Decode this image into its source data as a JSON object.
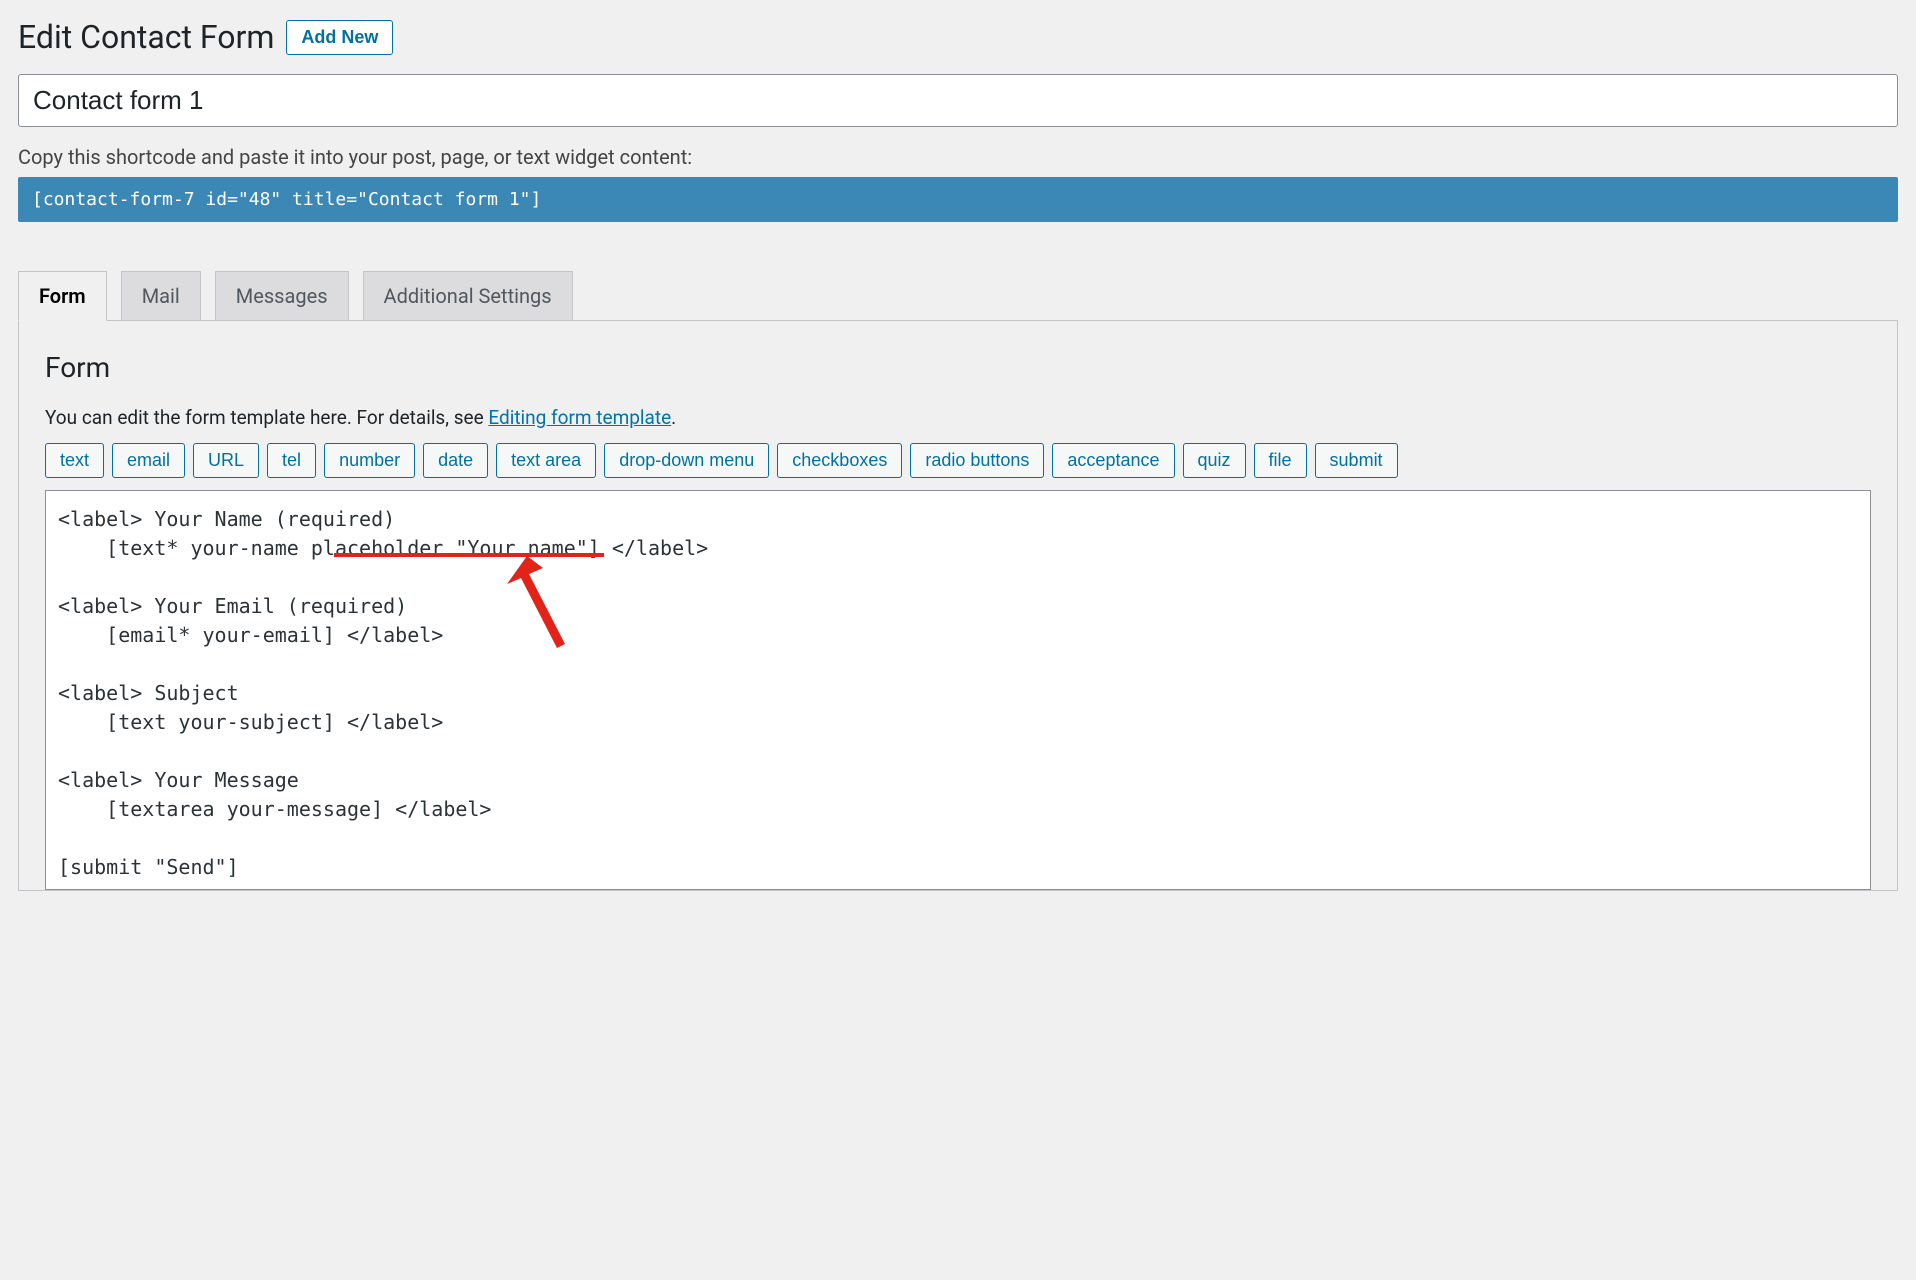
{
  "header": {
    "title": "Edit Contact Form",
    "add_new": "Add New"
  },
  "form_title": "Contact form 1",
  "shortcode_help": "Copy this shortcode and paste it into your post, page, or text widget content:",
  "shortcode": "[contact-form-7 id=\"48\" title=\"Contact form 1\"]",
  "tabs": {
    "form": "Form",
    "mail": "Mail",
    "messages": "Messages",
    "additional": "Additional Settings"
  },
  "panel": {
    "heading": "Form",
    "desc_prefix": "You can edit the form template here. For details, see ",
    "desc_link": "Editing form template",
    "desc_suffix": ".",
    "tags": [
      "text",
      "email",
      "URL",
      "tel",
      "number",
      "date",
      "text area",
      "drop-down menu",
      "checkboxes",
      "radio buttons",
      "acceptance",
      "quiz",
      "file",
      "submit"
    ],
    "code": "<label> Your Name (required)\n    [text* your-name placeholder \"Your name\"] </label>\n\n<label> Your Email (required)\n    [email* your-email] </label>\n\n<label> Subject\n    [text your-subject] </label>\n\n<label> Your Message\n    [textarea your-message] </label>\n\n[submit \"Send\"]"
  }
}
